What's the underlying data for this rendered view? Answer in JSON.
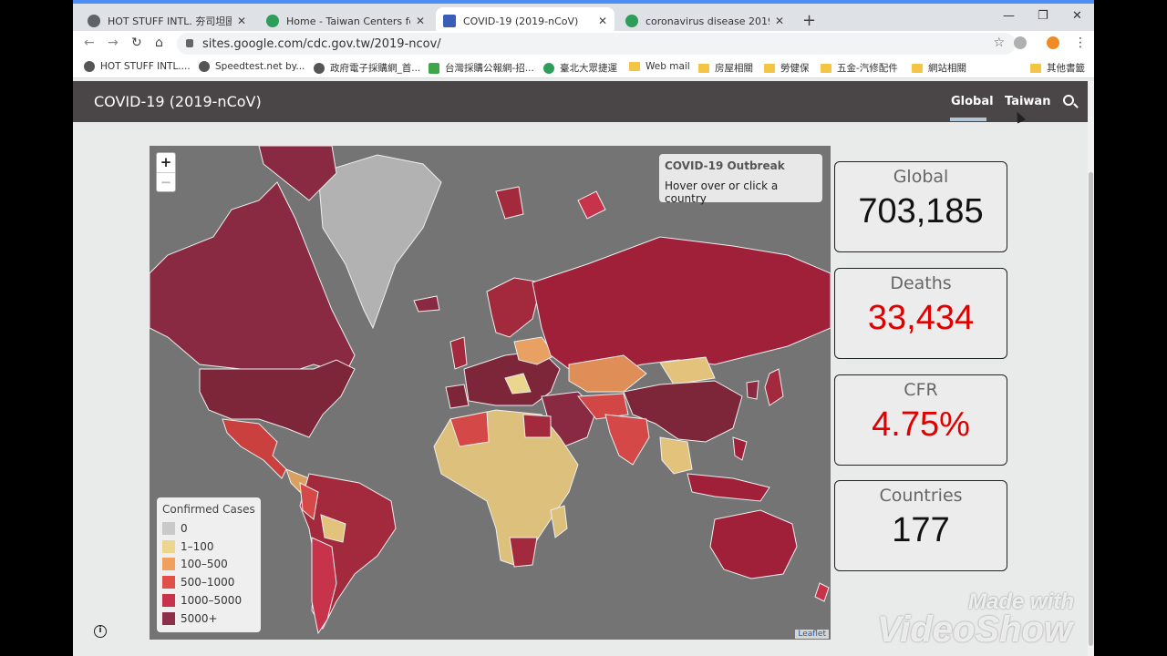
{
  "browser": {
    "tabs": [
      {
        "title": "HOT STUFF INTL. 夯司坦國際",
        "active": false
      },
      {
        "title": "Home - Taiwan Centers for Dise",
        "active": false
      },
      {
        "title": "COVID-19 (2019-nCoV)",
        "active": true
      },
      {
        "title": "coronavirus disease 2019(COV",
        "active": false
      }
    ],
    "url": "sites.google.com/cdc.gov.tw/2019-ncov/",
    "bookmarks": [
      {
        "label": "HOT STUFF INTL....",
        "icon": "globe-icon"
      },
      {
        "label": "Speedtest.net by...",
        "icon": "speedometer-icon"
      },
      {
        "label": "政府電子採購網_首...",
        "icon": "globe-icon"
      },
      {
        "label": "台灣採購公報網-招...",
        "icon": "site-icon"
      },
      {
        "label": "臺北大眾捷運",
        "icon": "metro-icon"
      },
      {
        "label": "Web mail",
        "icon": "folder-icon"
      },
      {
        "label": "房屋相關",
        "icon": "folder-icon"
      },
      {
        "label": "勞健保",
        "icon": "folder-icon"
      },
      {
        "label": "五金-汽修配件",
        "icon": "folder-icon"
      },
      {
        "label": "網站相關",
        "icon": "folder-icon"
      },
      {
        "label": "其他書籤",
        "icon": "folder-icon"
      }
    ]
  },
  "site": {
    "title": "COVID-19 (2019-nCoV)",
    "nav": [
      {
        "label": "Global",
        "selected": true
      },
      {
        "label": "Taiwan",
        "selected": false
      }
    ]
  },
  "map": {
    "zoom_in": "+",
    "zoom_out": "−",
    "info_title": "COVID-19 Outbreak",
    "info_hint": "Hover over or click a country",
    "legend_title": "Confirmed Cases",
    "legend": [
      {
        "label": "0",
        "color": "#c9c9c9"
      },
      {
        "label": "1–100",
        "color": "#ecd58c"
      },
      {
        "label": "100–500",
        "color": "#f0a05c"
      },
      {
        "label": "500–1000",
        "color": "#e0504a"
      },
      {
        "label": "1000–5000",
        "color": "#c8334c"
      },
      {
        "label": "5000+",
        "color": "#8c2f48"
      }
    ],
    "attribution": "Leaflet"
  },
  "stats": [
    {
      "label": "Global",
      "value": "703,185",
      "color": "#111111"
    },
    {
      "label": "Deaths",
      "value": "33,434",
      "color": "#e00000"
    },
    {
      "label": "CFR",
      "value": "4.75%",
      "color": "#e00000"
    },
    {
      "label": "Countries",
      "value": "177",
      "color": "#111111"
    }
  ],
  "watermark": {
    "line1": "Made with",
    "line2": "VideoShow"
  }
}
